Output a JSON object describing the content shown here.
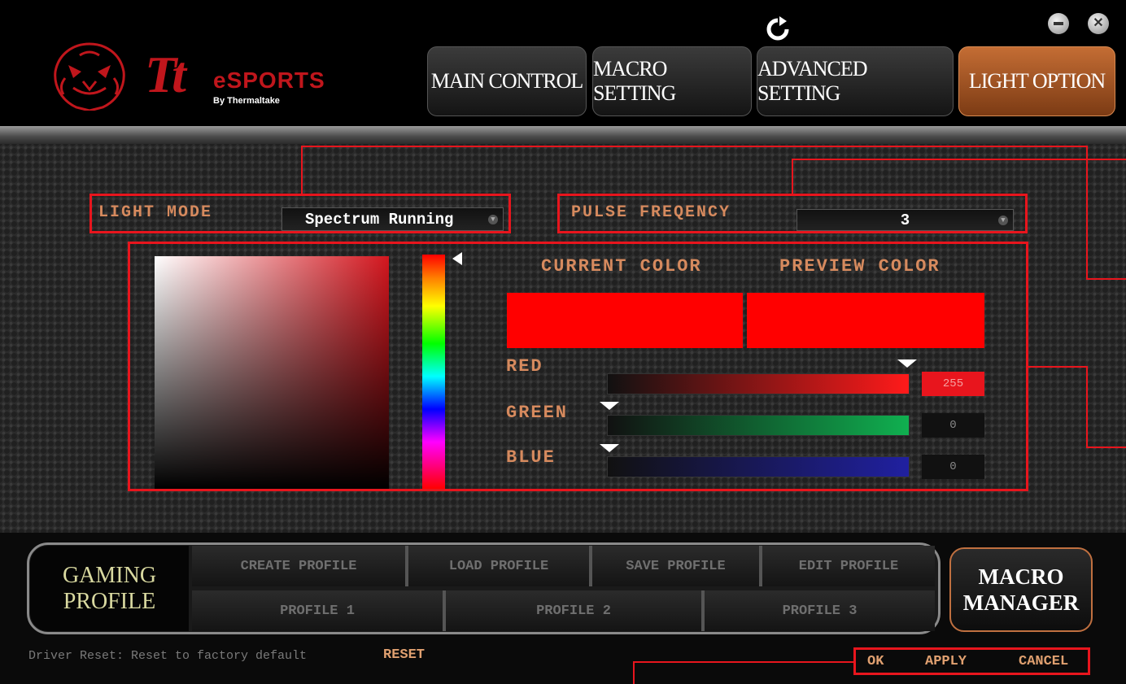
{
  "header": {
    "brand_mark": "Tt",
    "brand_name": "eSPORTS",
    "brand_sub": "By Thermaltake",
    "tabs": [
      {
        "label": "MAIN CONTROL",
        "active": false
      },
      {
        "label": "MACRO SETTING",
        "active": false
      },
      {
        "label": "ADVANCED SETTING",
        "active": false
      },
      {
        "label": "LIGHT OPTION",
        "active": true
      }
    ],
    "icons": {
      "refresh": "refresh-icon",
      "minimize": "minimize-icon",
      "close": "close-icon"
    }
  },
  "light": {
    "mode_label": "LIGHT MODE",
    "mode_value": "Spectrum Running",
    "pulse_label": "PULSE FREQENCY",
    "pulse_value": "3",
    "current_color_label": "CURRENT COLOR",
    "preview_color_label": "PREVIEW COLOR",
    "current_color": "#ff0000",
    "preview_color": "#ff0000",
    "channels": [
      {
        "label": "RED",
        "value": "255",
        "fraction": 1.0
      },
      {
        "label": "GREEN",
        "value": "0",
        "fraction": 0.0
      },
      {
        "label": "BLUE",
        "value": "0",
        "fraction": 0.0
      }
    ]
  },
  "profiles": {
    "gaming_line1": "GAMING",
    "gaming_line2": "PROFILE",
    "actions": [
      "CREATE PROFILE",
      "LOAD PROFILE",
      "SAVE PROFILE",
      "EDIT PROFILE"
    ],
    "slots": [
      "PROFILE 1",
      "PROFILE 2",
      "PROFILE 3"
    ],
    "macro_line1": "MACRO",
    "macro_line2": "MANAGER"
  },
  "footer": {
    "driver_reset_text": "Driver Reset: Reset to factory default",
    "reset_label": "RESET",
    "ok_label": "OK",
    "apply_label": "APPLY",
    "cancel_label": "CANCEL"
  },
  "colors": {
    "accent_red": "#e8151d",
    "label_orange": "#d68a5e",
    "active_tab": "#c46d34"
  }
}
